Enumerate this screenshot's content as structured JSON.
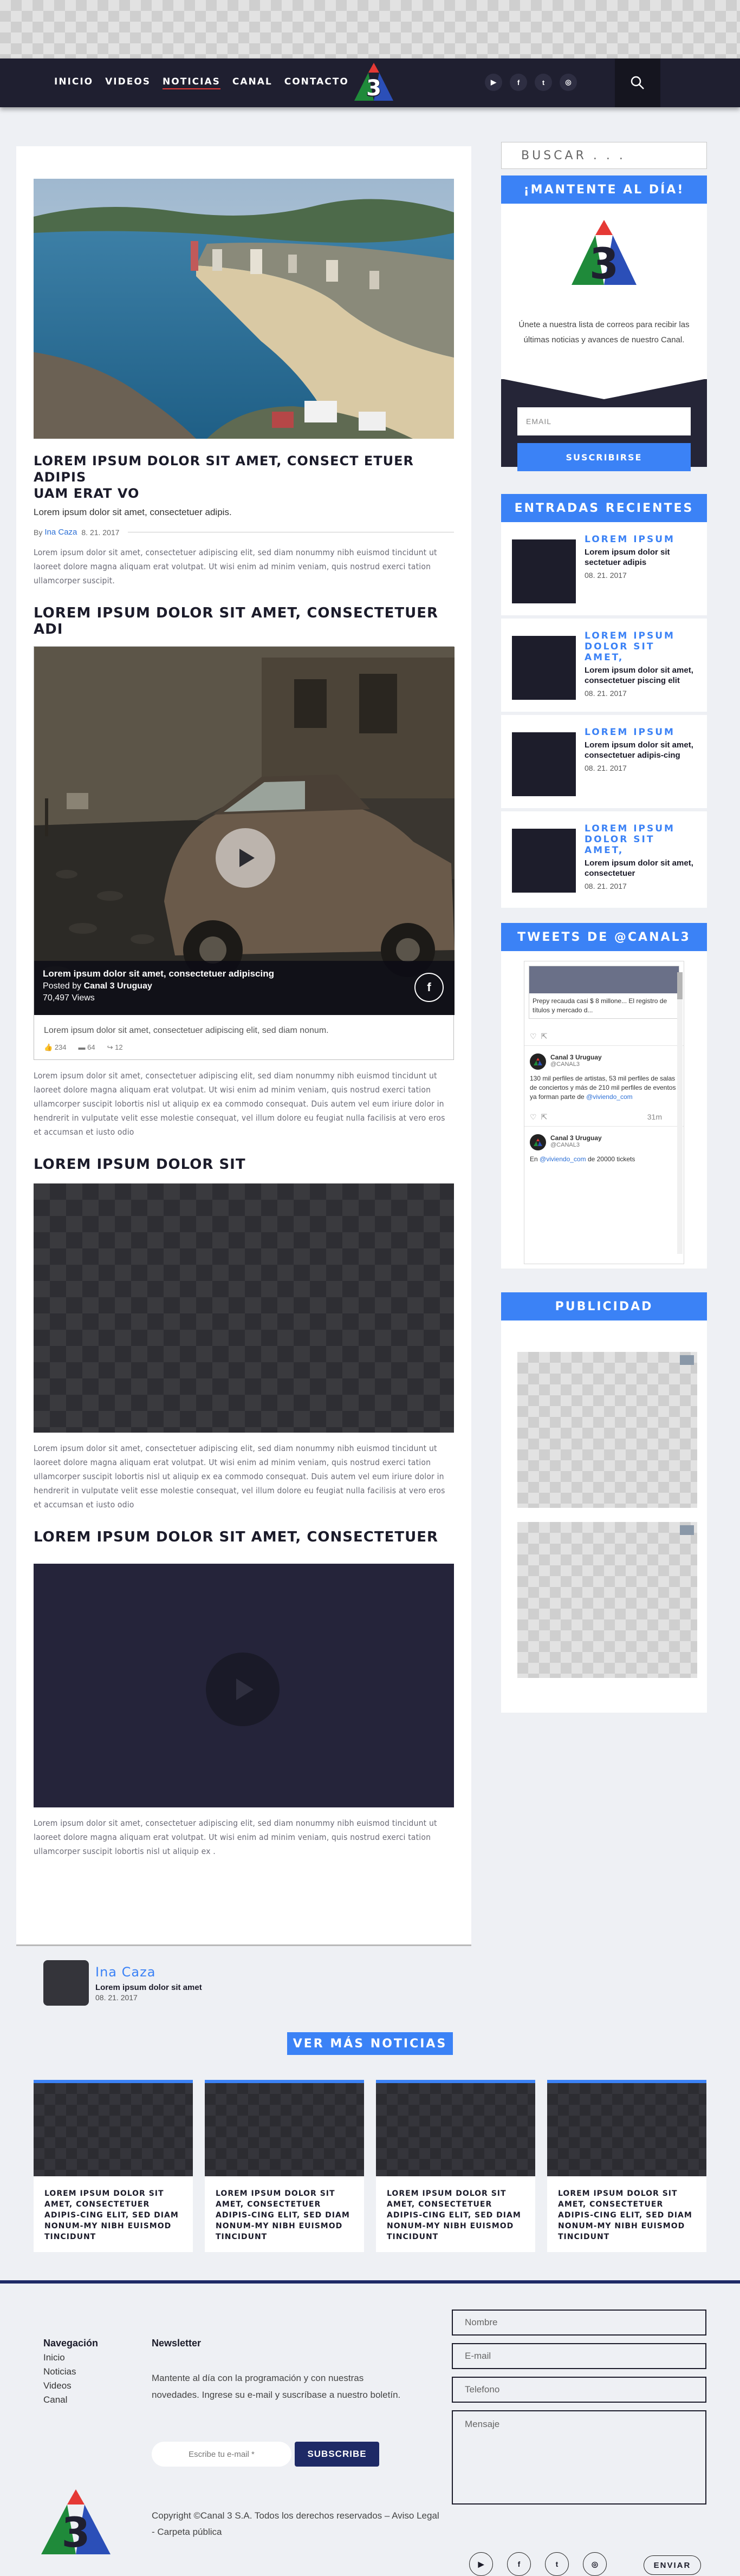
{
  "nav": {
    "items": [
      "INICIO",
      "VIDEOS",
      "NOTICIAS",
      "CANAL",
      "CONTACTO"
    ],
    "active": "NOTICIAS"
  },
  "header": {
    "social": [
      "youtube-icon",
      "facebook-icon",
      "twitter-icon",
      "instagram-icon"
    ]
  },
  "colors": {
    "accent": "#3b82f6",
    "navy": "#1f1f30",
    "footer_line": "#1e2a66"
  },
  "article": {
    "title_l1": "LOREM IPSUM DOLOR SIT AMET, CONSECT ETUER ADIPIS",
    "title_l2": "UAM ERAT VO",
    "subtitle": "Lorem ipsum dolor sit amet, consectetuer adipis.",
    "by": "By",
    "author": "Ina Caza",
    "date": "8. 21. 2017",
    "p1": "Lorem ipsum dolor sit amet, consectetuer adipiscing elit, sed diam nonummy nibh euismod tincidunt ut laoreet dolore magna aliquam erat volutpat. Ut wisi enim ad minim veniam, quis nostrud exerci tation ullamcorper suscipit.",
    "h2_1": "LOREM IPSUM DOLOR SIT AMET, CONSECTETUER ADI",
    "video": {
      "caption": "Lorem ipsum dolor sit amet, consectetuer adipiscing",
      "posted_prefix": "Posted by",
      "posted_by": "Canal 3 Uruguay",
      "views": "70,497 Views",
      "desc": "Lorem ipsum dolor sit amet, consectetuer adipiscing elit, sed diam nonum.",
      "stats": [
        "234",
        "64",
        "12"
      ]
    },
    "p2": "Lorem ipsum dolor sit amet, consectetuer adipiscing elit, sed diam nonummy nibh euismod tincidunt ut laoreet dolore magna aliquam erat volutpat. Ut wisi enim ad minim veniam, quis nostrud exerci tation ullamcorper suscipit lobortis nisl ut aliquip ex ea commodo consequat. Duis autem vel eum iriure dolor in hendrerit in vulputate velit esse molestie consequat, vel illum dolore eu feugiat nulla facilisis at vero eros et accumsan et iusto odio",
    "h2_2": "LOREM IPSUM DOLOR SIT",
    "p3": "Lorem ipsum dolor sit amet, consectetuer adipiscing elit, sed diam nonummy nibh euismod tincidunt ut laoreet dolore magna aliquam erat volutpat. Ut wisi enim ad minim veniam, quis nostrud exerci tation ullamcorper suscipit lobortis nisl ut aliquip ex ea commodo consequat. Duis autem vel eum iriure dolor in hendrerit in vulputate velit esse molestie consequat, vel illum dolore eu feugiat nulla facilisis at vero eros et accumsan et iusto odio",
    "h2_3": "LOREM IPSUM DOLOR SIT AMET, CONSECTETUER",
    "p4": "Lorem ipsum dolor sit amet, consectetuer adipiscing elit, sed diam nonummy nibh euismod tincidunt ut laoreet dolore magna aliquam erat volutpat. Ut wisi enim ad minim veniam, quis nostrud exerci tation ullamcorper suscipit lobortis nisl ut aliquip ex ."
  },
  "author_box": {
    "name": "Ina Caza",
    "sub": "Lorem ipsum dolor sit amet",
    "date": "08. 21. 2017"
  },
  "more_button": "VER MÁS NOTICIAS",
  "cards": [
    "LOREM IPSUM DOLOR SIT AMET, CONSECTETUER ADIPIS-CING ELIT, SED DIAM NONUM-MY NIBH EUISMOD TINCIDUNT",
    "LOREM IPSUM DOLOR SIT AMET, CONSECTETUER ADIPIS-CING ELIT, SED DIAM NONUM-MY NIBH EUISMOD TINCIDUNT",
    "LOREM IPSUM DOLOR SIT AMET, CONSECTETUER ADIPIS-CING ELIT, SED DIAM NONUM-MY NIBH EUISMOD TINCIDUNT",
    "LOREM IPSUM DOLOR SIT AMET, CONSECTETUER ADIPIS-CING ELIT, SED DIAM NONUM-MY NIBH EUISMOD TINCIDUNT"
  ],
  "sidebar": {
    "search_placeholder": "BUSCAR . . .",
    "newsletter": {
      "title": "¡MANTENTE AL DÍA!",
      "text": "Únete a nuestra lista de correos para recibir las últimas noticias y avances de nuestro Canal.",
      "email_placeholder": "EMAIL",
      "button": "SUSCRIBIRSE"
    },
    "recent_title": "ENTRADAS RECIENTES",
    "recent": [
      {
        "title": "LOREM IPSUM",
        "sub": "Lorem ipsum dolor sit sectetuer adipis",
        "date": "08. 21. 2017"
      },
      {
        "title": "LOREM IPSUM DOLOR SIT AMET,",
        "sub": "Lorem ipsum dolor sit amet, consectetuer piscing elit",
        "date": "08. 21. 2017"
      },
      {
        "title": "LOREM IPSUM",
        "sub": "Lorem ipsum dolor sit amet, consectetuer adipis-cing",
        "date": "08. 21. 2017"
      },
      {
        "title": "LOREM IPSUM DOLOR SIT AMET,",
        "sub": "Lorem ipsum dolor sit amet, consectetuer",
        "date": "08. 21. 2017"
      }
    ],
    "tweets_title": "TWEETS DE @CANAL3",
    "tweets": {
      "card_text": "Prepy recauda casi $ 8 millone... El registro de títulos y mercado d...",
      "user_name": "Canal 3 Uruguay",
      "handle": "@CANAL3",
      "tweet1": "130 mil perfiles de artistas, 53 mil perfiles de salas de conciertos y más de 210 mil perfiles de eventos ya forman parte de",
      "tweet1_link": "@viviendo_com",
      "time1": "31m",
      "tweet2_prefix": "En",
      "tweet2_link": "@viviendo_com",
      "tweet2_rest": "de 20000 tickets"
    },
    "publicidad_title": "PUBLICIDAD"
  },
  "footer": {
    "nav_title": "Navegación",
    "nav_links": [
      "Inicio",
      "Noticias",
      "Videos",
      "Canal"
    ],
    "news_title": "Newsletter",
    "news_text": "Mantente al día con la programación y con nuestras novedades. Ingrese su e-mail y suscríbase a nuestro boletín.",
    "email_placeholder": "Escribe tu e-mail *",
    "subscribe": "SUBSCRIBE",
    "copyright": "Copyright ©Canal 3 S.A. Todos los derechos reservados – Aviso Legal - Carpeta pública",
    "form": [
      "Nombre",
      "E-mail",
      "Telefono",
      "Mensaje"
    ],
    "send": "ENVIAR"
  }
}
